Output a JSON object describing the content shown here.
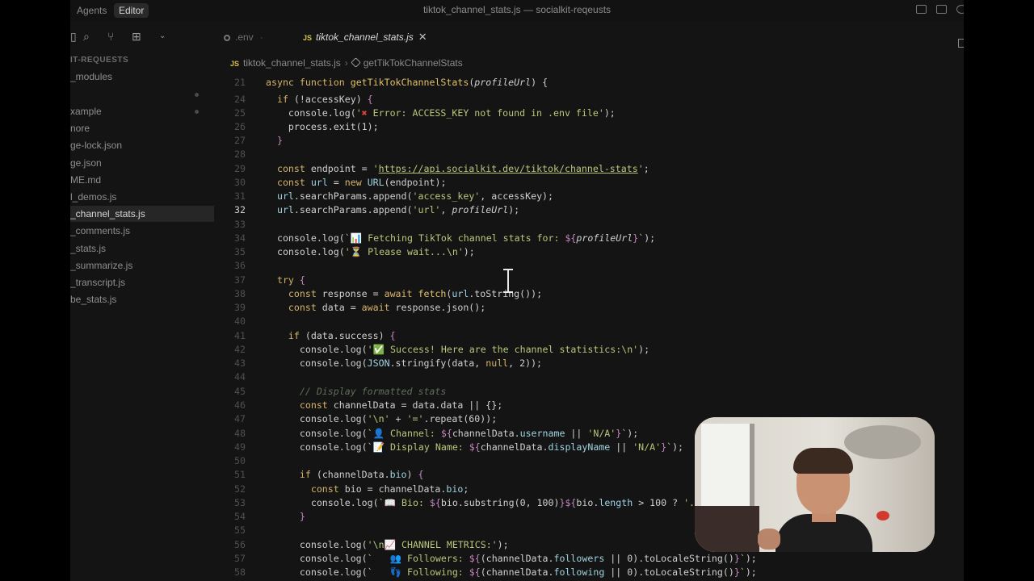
{
  "titlebar": {
    "tabs": [
      "Agents",
      "Editor"
    ],
    "active_tab": "Editor",
    "title": "tiktok_channel_stats.js — socialkit-reqeusts"
  },
  "sidebar": {
    "section_title": "IT-REQUESTS",
    "items": [
      {
        "label": "_modules",
        "active": false
      },
      {
        "label": "",
        "active": false
      },
      {
        "label": "xample",
        "active": false
      },
      {
        "label": "nore",
        "active": false
      },
      {
        "label": "ge-lock.json",
        "active": false
      },
      {
        "label": "ge.json",
        "active": false
      },
      {
        "label": "ME.md",
        "active": false
      },
      {
        "label": "l_demos.js",
        "active": false
      },
      {
        "label": "_channel_stats.js",
        "active": true
      },
      {
        "label": "_comments.js",
        "active": false
      },
      {
        "label": "_stats.js",
        "active": false
      },
      {
        "label": "_summarize.js",
        "active": false
      },
      {
        "label": "_transcript.js",
        "active": false
      },
      {
        "label": "be_stats.js",
        "active": false
      }
    ]
  },
  "editor": {
    "tabs": [
      {
        "label": ".env",
        "active": false,
        "icon": "gear-icon"
      },
      {
        "label": "tiktok_channel_stats.js",
        "active": true,
        "icon": "js-icon"
      }
    ],
    "breadcrumb": {
      "file": "tiktok_channel_stats.js",
      "symbol": "getTikTokChannelStats"
    },
    "current_line": 32
  },
  "colors": {
    "background": "#141414",
    "keyword": "#d6b36a",
    "string": "#b9c77a"
  }
}
